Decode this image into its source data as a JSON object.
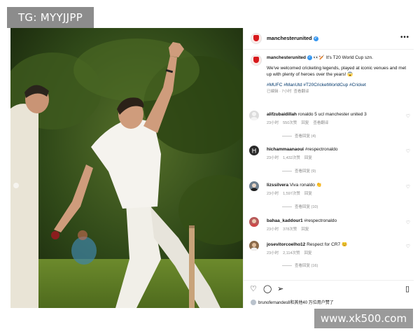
{
  "watermarks": {
    "top_left": "TG: MYYJJPP",
    "bottom_right": "www.xk500.com"
  },
  "post": {
    "account": "manchesterunited",
    "caption_emoji": "👀🏏",
    "caption_line1": "It's T20 World Cup szn.",
    "caption_body": "We've welcomed cricketing legends, played at iconic venues and met up with plenty of heroes over the years! 😱",
    "hashtags": "#MUFC #ManUtd #T20CricketWorldCup #Cricket",
    "meta_edited": "已编辑",
    "meta_time": "7小时",
    "meta_translate": "查看翻译"
  },
  "comments": [
    {
      "user": "alifzubaidillah",
      "text": "ronaldo 5 ucl manchester united 3",
      "time": "23小时",
      "likes": "550次赞",
      "reply": "回复",
      "translate": "查看翻译",
      "replies": "查看回复 (4)",
      "avatar": "default-avatar-icon"
    },
    {
      "user": "hichammaanaoui",
      "text": "#respectronaldo",
      "time": "23小时",
      "likes": "1,432次赞",
      "reply": "回复",
      "translate": "",
      "replies": "查看回复 (9)",
      "avatar": "letter-avatar"
    },
    {
      "user": "lizssilvera",
      "text": "Viva ronaldo 👏",
      "time": "23小时",
      "likes": "1,597次赞",
      "reply": "回复",
      "translate": "",
      "replies": "查看回复 (10)",
      "avatar": "photo-avatar"
    },
    {
      "user": "bahaa_kaddour1",
      "text": "#respectronaldo",
      "time": "23小时",
      "likes": "378次赞",
      "reply": "回复",
      "translate": "",
      "replies": "",
      "avatar": "photo-avatar"
    },
    {
      "user": "josevitorcoelho12",
      "text": "Respect for CR7 😊",
      "time": "23小时",
      "likes": "2,114次赞",
      "reply": "回复",
      "translate": "",
      "replies": "查看回复 (16)",
      "avatar": "photo-avatar"
    }
  ],
  "actions": {
    "heart": "♡",
    "comment": "◯",
    "share": "➢",
    "save": "▯",
    "liked_by": "brunofernandes8和其他40 万位用户赞了"
  },
  "colors": {
    "link": "#00376b",
    "meta": "#8e8e8e",
    "verified": "#3797f0",
    "brand": "#d7191c"
  }
}
